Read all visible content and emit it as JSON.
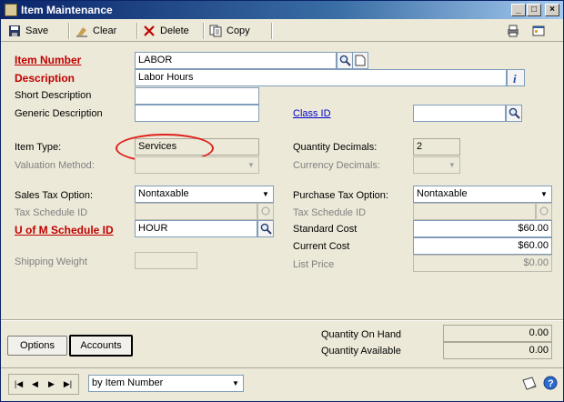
{
  "window": {
    "title": "Item Maintenance"
  },
  "toolbar": {
    "save": "Save",
    "clear": "Clear",
    "delete": "Delete",
    "copy": "Copy"
  },
  "left": {
    "item_number_label": "Item Number",
    "item_number_value": "LABOR",
    "description_label": "Description",
    "description_value": "Labor Hours",
    "short_description_label": "Short Description",
    "short_description_value": "",
    "generic_description_label": "Generic Description",
    "generic_description_value": "",
    "item_type_label": "Item Type:",
    "item_type_value": "Services",
    "valuation_method_label": "Valuation Method:",
    "valuation_method_value": "",
    "sales_tax_option_label": "Sales Tax Option:",
    "sales_tax_option_value": "Nontaxable",
    "tax_schedule_id_label": "Tax Schedule ID",
    "tax_schedule_id_value": "",
    "uofm_label": "U of M Schedule ID",
    "uofm_value": "HOUR",
    "shipping_weight_label": "Shipping Weight",
    "shipping_weight_value": ""
  },
  "right": {
    "class_id_label": "Class ID",
    "class_id_value": "",
    "quantity_decimals_label": "Quantity Decimals:",
    "quantity_decimals_value": "2",
    "currency_decimals_label": "Currency Decimals:",
    "currency_decimals_value": "",
    "purchase_tax_option_label": "Purchase Tax Option:",
    "purchase_tax_option_value": "Nontaxable",
    "tax_schedule_id_label": "Tax Schedule ID",
    "tax_schedule_id_value": "",
    "standard_cost_label": "Standard Cost",
    "standard_cost_value": "$60.00",
    "current_cost_label": "Current Cost",
    "current_cost_value": "$60.00",
    "list_price_label": "List Price",
    "list_price_value": "$0.00"
  },
  "footer": {
    "options_button": "Options",
    "accounts_button": "Accounts",
    "quantity_on_hand_label": "Quantity On Hand",
    "quantity_on_hand_value": "0.00",
    "quantity_available_label": "Quantity Available",
    "quantity_available_value": "0.00",
    "sort_value": "by Item Number"
  },
  "colors": {
    "required": "#c00000",
    "link": "#0000cc",
    "annotation": "#e0201a"
  },
  "icons": [
    "save-icon",
    "clear-icon",
    "delete-icon",
    "copy-icon",
    "print-icon",
    "window-icon",
    "lookup-icon",
    "note-icon",
    "info-icon",
    "help-icon"
  ]
}
